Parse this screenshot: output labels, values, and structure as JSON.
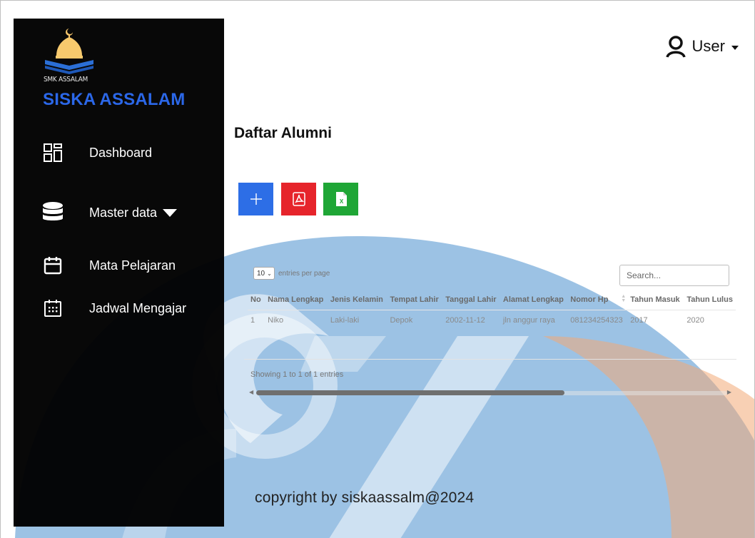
{
  "sidebar": {
    "school_small": "SMK ASSALAM",
    "brand": "SISKA ASSALAM",
    "items": [
      {
        "label": "Dashboard",
        "icon": "dashboard-grid-icon"
      },
      {
        "label": "Master data",
        "icon": "database-icon"
      },
      {
        "label": "Mata Pelajaran",
        "icon": "calendar-icon"
      },
      {
        "label": "Jadwal Mengajar",
        "icon": "calendar-days-icon"
      }
    ]
  },
  "header": {
    "user_label": "User"
  },
  "page": {
    "title": "Daftar Alumni"
  },
  "toolbar": {
    "add_icon": "plus-icon",
    "pdf_icon": "pdf-icon",
    "excel_icon": "excel-icon"
  },
  "table": {
    "entries_value": "10",
    "entries_label": "entries per page",
    "search_placeholder": "Search...",
    "columns": [
      "No",
      "Nama Lengkap",
      "Jenis Kelamin",
      "Tempat Lahir",
      "Tanggal Lahir",
      "Alamat Lengkap",
      "Nomor Hp",
      "Tahun Masuk",
      "Tahun Lulus"
    ],
    "rows": [
      [
        "1",
        "Niko",
        "Laki-laki",
        "Depok",
        "2002-11-12",
        "jln anggur raya",
        "081234254323",
        "2017",
        "2020"
      ]
    ],
    "info": "Showing 1 to 1 of 1 entries"
  },
  "footer": {
    "copyright": "copyright by siskaassalm@2024"
  },
  "colors": {
    "sidebar_bg": "#000000",
    "brand": "#2b67e8",
    "add_button": "#2d6ee6",
    "pdf_button": "#e6242b",
    "excel_button": "#1fa636",
    "watermark_blue": "#4a8fcd",
    "watermark_orange": "#f2a977"
  }
}
